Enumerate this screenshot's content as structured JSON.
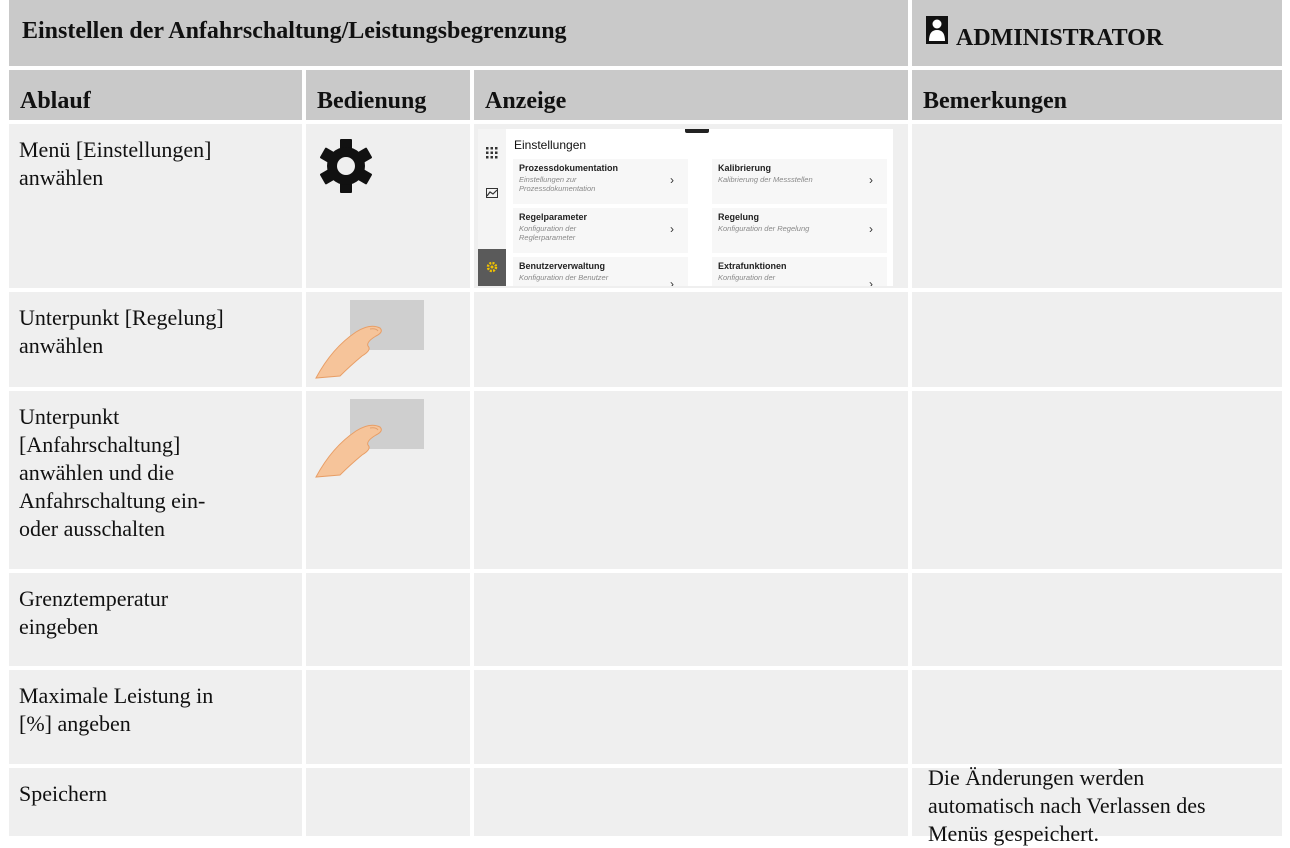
{
  "header": {
    "title": "Einstellen der Anfahrschaltung/Leistungsbegrenzung",
    "role": "ADMINISTRATOR"
  },
  "columns": [
    "Ablauf",
    "Bedienung",
    "Anzeige",
    "Bemerkungen"
  ],
  "rows": [
    {
      "ablauf": "Menü [Einstellungen]\nanwählen",
      "bedienung_icon": "gear-icon",
      "anzeige": "settings-screenshot",
      "bemerkungen": ""
    },
    {
      "ablauf": "Unterpunkt [Regelung]\nanwählen",
      "bedienung_icon": "touch-finger-icon",
      "anzeige": "",
      "bemerkungen": ""
    },
    {
      "ablauf": "Unterpunkt\n[Anfahrschaltung]\nanwählen und die\nAnfahrschaltung ein-\noder ausschalten",
      "bedienung_icon": "touch-finger-icon",
      "anzeige": "",
      "bemerkungen": ""
    },
    {
      "ablauf": "Grenztemperatur\neingeben",
      "bedienung_icon": "",
      "anzeige": "",
      "bemerkungen": ""
    },
    {
      "ablauf": "Maximale Leistung in\n[%] angeben",
      "bedienung_icon": "",
      "anzeige": "",
      "bemerkungen": ""
    },
    {
      "ablauf": "Speichern",
      "bedienung_icon": "",
      "anzeige": "",
      "bemerkungen": "Die Änderungen werden\nautomatisch nach Verlassen des\nMenüs gespeichert."
    }
  ],
  "screenshot": {
    "title": "Einstellungen",
    "cards": [
      {
        "title": "Prozessdokumentation",
        "subtitle": "Einstellungen zur\nProzessdokumentation"
      },
      {
        "title": "Kalibrierung",
        "subtitle": "Kalibrierung der Messstellen"
      },
      {
        "title": "Regelparameter",
        "subtitle": "Konfiguration der\nReglerparameter"
      },
      {
        "title": "Regelung",
        "subtitle": "Konfiguration der Regelung"
      },
      {
        "title": "Benutzerverwaltung",
        "subtitle": "Konfiguration der Benutzer"
      },
      {
        "title": "Extrafunktionen",
        "subtitle": "Konfiguration der"
      }
    ],
    "chevron": "›",
    "rail_icons": [
      "grid-icon",
      "chart-icon",
      "gear-icon"
    ]
  },
  "colors": {
    "header_bg": "#c9c9c9",
    "cell_bg": "#efefef",
    "accent": "#f2c200"
  }
}
